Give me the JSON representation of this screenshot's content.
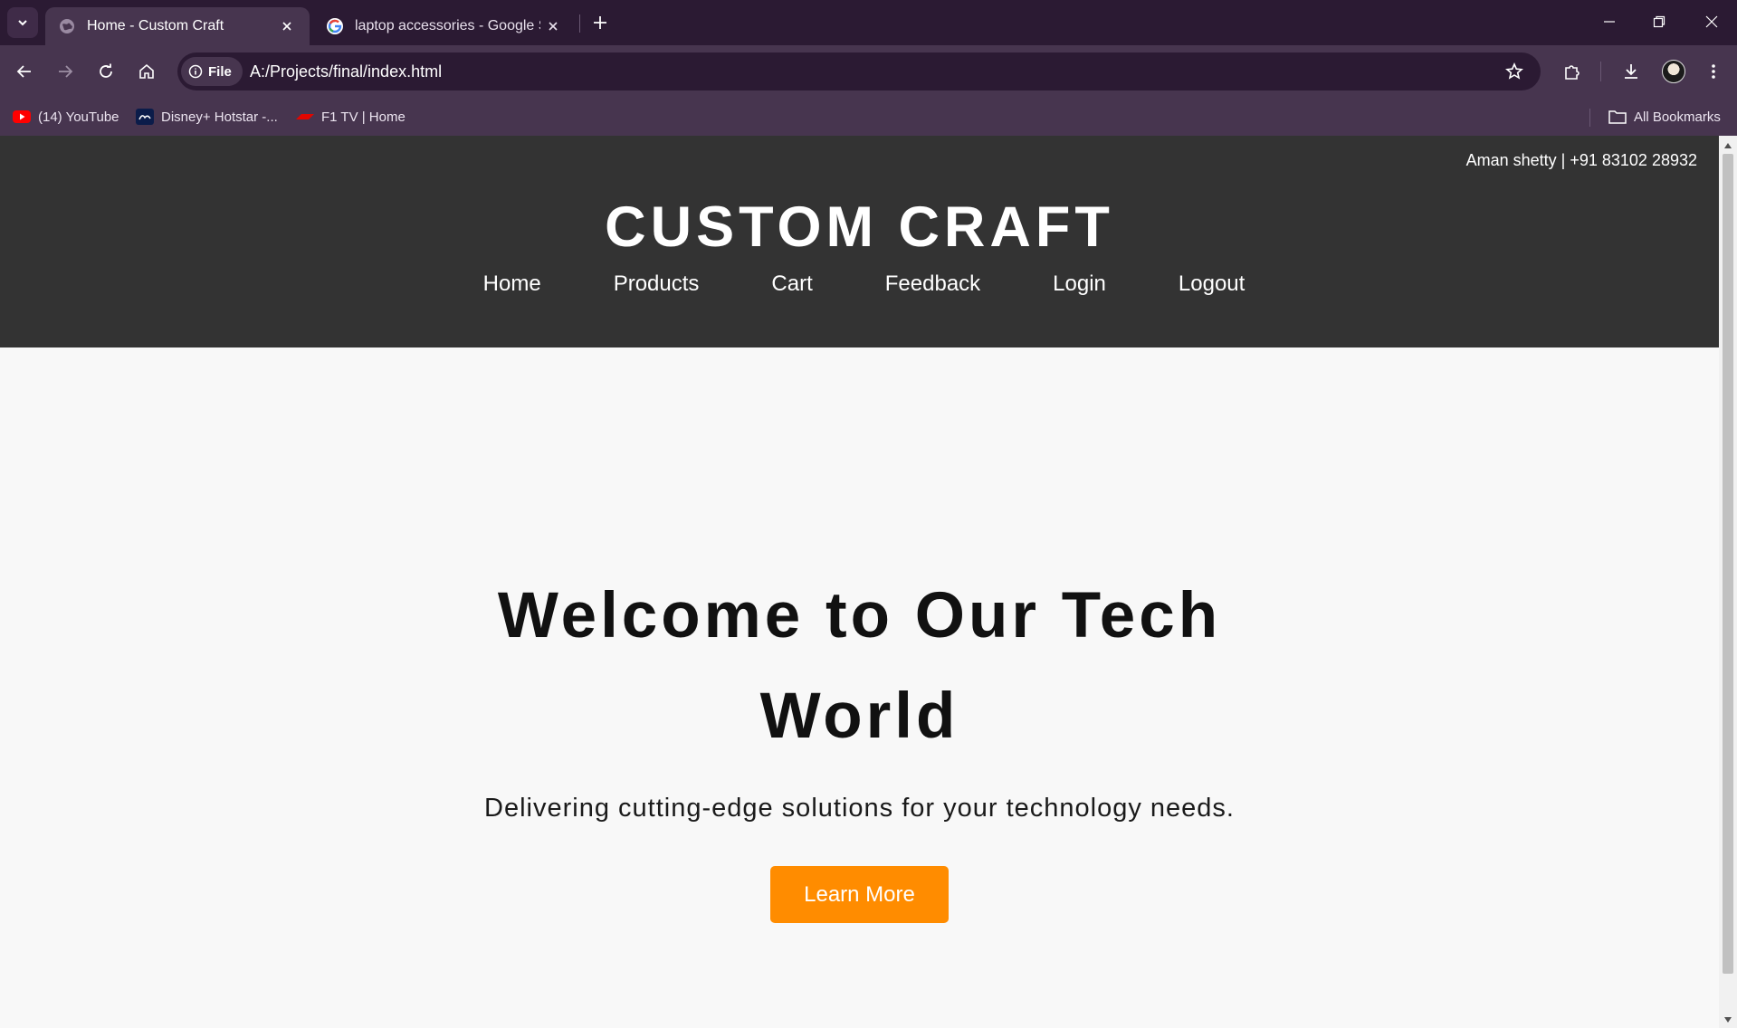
{
  "browser": {
    "tabs": [
      {
        "title": "Home - Custom Craft",
        "active": true,
        "favicon": "globe-icon"
      },
      {
        "title": "laptop accessories - Google Search",
        "active": false,
        "favicon": "google-icon"
      }
    ],
    "address_bar": {
      "chip_label": "File",
      "url": "A:/Projects/final/index.html"
    },
    "bookmarks": [
      {
        "label": "(14) YouTube",
        "icon": "youtube-icon"
      },
      {
        "label": "Disney+ Hotstar -...",
        "icon": "hotstar-icon"
      },
      {
        "label": "F1 TV | Home",
        "icon": "f1-icon"
      }
    ],
    "all_bookmarks_label": "All Bookmarks"
  },
  "site": {
    "contact": "Aman shetty | +91 83102 28932",
    "brand": "CUSTOM CRAFT",
    "nav": [
      "Home",
      "Products",
      "Cart",
      "Feedback",
      "Login",
      "Logout"
    ],
    "hero": {
      "title": "Welcome to Our Tech World",
      "subtitle": "Delivering cutting-edge solutions for your technology needs.",
      "cta_label": "Learn More"
    }
  },
  "colors": {
    "tabstrip": "#2b1a33",
    "toolbar": "#47354f",
    "header_bg": "#333333",
    "cta": "#ff8c00",
    "page_bg": "#f8f8f8"
  }
}
